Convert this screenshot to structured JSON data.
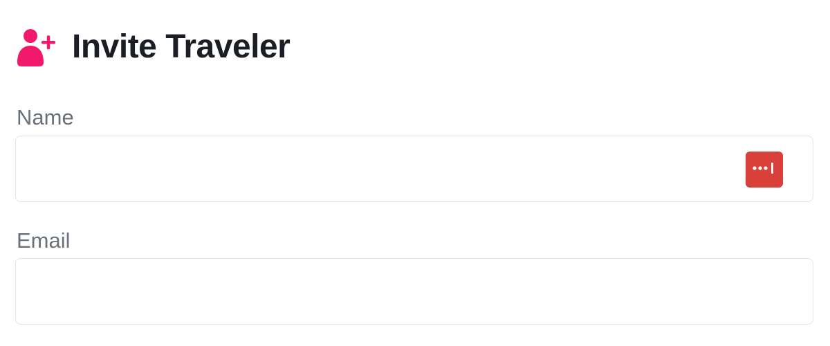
{
  "header": {
    "title": "Invite Traveler",
    "icon": "user-plus-icon",
    "accent_color": "#f2186b"
  },
  "form": {
    "name": {
      "label": "Name",
      "value": "",
      "placeholder": ""
    },
    "email": {
      "label": "Email",
      "value": "",
      "placeholder": ""
    }
  },
  "password_manager": {
    "icon": "password-manager-icon",
    "color": "#d9403a"
  }
}
